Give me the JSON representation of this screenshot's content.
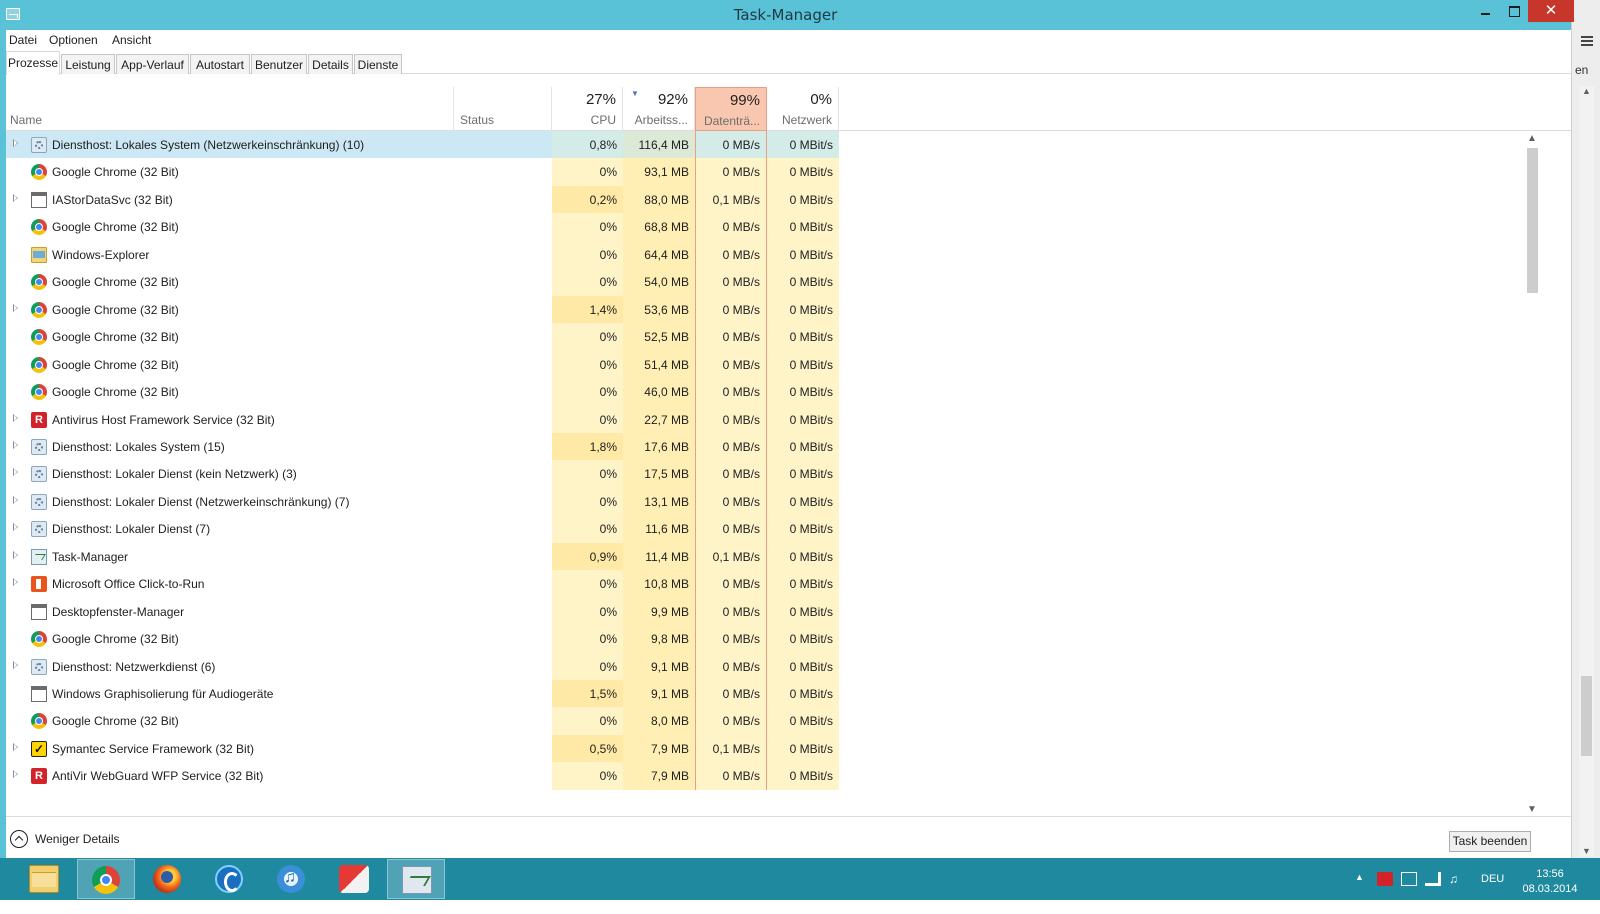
{
  "window": {
    "title": "Task-Manager"
  },
  "menu": [
    "Datei",
    "Optionen",
    "Ansicht"
  ],
  "tabs": [
    "Prozesse",
    "Leistung",
    "App-Verlauf",
    "Autostart",
    "Benutzer",
    "Details",
    "Dienste"
  ],
  "columns": {
    "name": "Name",
    "status": "Status",
    "cpu": {
      "pct": "27%",
      "label": "CPU"
    },
    "memory": {
      "pct": "92%",
      "label": "Arbeitss..."
    },
    "disk": {
      "pct": "99%",
      "label": "Datenträ..."
    },
    "network": {
      "pct": "0%",
      "label": "Netzwerk"
    }
  },
  "colors": {
    "titlebar": "#5ac2d6",
    "taskbar": "#1f8a9f",
    "hot_column": "#f9c7b0",
    "selected_row": "#cce8f4",
    "close_button": "#c7362b"
  },
  "rows": [
    {
      "name": "Diensthost: Lokales System (Netzwerkeinschränkung) (10)",
      "icon": "gear-icon",
      "expandable": true,
      "selected": true,
      "cpu": "0,8%",
      "mem": "116,4 MB",
      "disk": "0 MB/s",
      "net": "0 MBit/s"
    },
    {
      "name": "Google Chrome (32 Bit)",
      "icon": "chrome-icon",
      "expandable": false,
      "cpu": "0%",
      "mem": "93,1 MB",
      "disk": "0 MB/s",
      "net": "0 MBit/s"
    },
    {
      "name": "IAStorDataSvc (32 Bit)",
      "icon": "window-icon",
      "expandable": true,
      "cpu": "0,2%",
      "mem": "88,0 MB",
      "disk": "0,1 MB/s",
      "net": "0 MBit/s"
    },
    {
      "name": "Google Chrome (32 Bit)",
      "icon": "chrome-icon",
      "expandable": false,
      "cpu": "0%",
      "mem": "68,8 MB",
      "disk": "0 MB/s",
      "net": "0 MBit/s"
    },
    {
      "name": "Windows-Explorer",
      "icon": "folder-icon",
      "expandable": false,
      "cpu": "0%",
      "mem": "64,4 MB",
      "disk": "0 MB/s",
      "net": "0 MBit/s"
    },
    {
      "name": "Google Chrome (32 Bit)",
      "icon": "chrome-icon",
      "expandable": false,
      "cpu": "0%",
      "mem": "54,0 MB",
      "disk": "0 MB/s",
      "net": "0 MBit/s"
    },
    {
      "name": "Google Chrome (32 Bit)",
      "icon": "chrome-icon",
      "expandable": true,
      "cpu": "1,4%",
      "mem": "53,6 MB",
      "disk": "0 MB/s",
      "net": "0 MBit/s"
    },
    {
      "name": "Google Chrome (32 Bit)",
      "icon": "chrome-icon",
      "expandable": false,
      "cpu": "0%",
      "mem": "52,5 MB",
      "disk": "0 MB/s",
      "net": "0 MBit/s"
    },
    {
      "name": "Google Chrome (32 Bit)",
      "icon": "chrome-icon",
      "expandable": false,
      "cpu": "0%",
      "mem": "51,4 MB",
      "disk": "0 MB/s",
      "net": "0 MBit/s"
    },
    {
      "name": "Google Chrome (32 Bit)",
      "icon": "chrome-icon",
      "expandable": false,
      "cpu": "0%",
      "mem": "46,0 MB",
      "disk": "0 MB/s",
      "net": "0 MBit/s"
    },
    {
      "name": "Antivirus Host Framework Service (32 Bit)",
      "icon": "avira-icon",
      "expandable": true,
      "cpu": "0%",
      "mem": "22,7 MB",
      "disk": "0 MB/s",
      "net": "0 MBit/s"
    },
    {
      "name": "Diensthost: Lokales System (15)",
      "icon": "gear-icon",
      "expandable": true,
      "cpu": "1,8%",
      "mem": "17,6 MB",
      "disk": "0 MB/s",
      "net": "0 MBit/s"
    },
    {
      "name": "Diensthost: Lokaler Dienst (kein Netzwerk) (3)",
      "icon": "gear-icon",
      "expandable": true,
      "cpu": "0%",
      "mem": "17,5 MB",
      "disk": "0 MB/s",
      "net": "0 MBit/s"
    },
    {
      "name": "Diensthost: Lokaler Dienst (Netzwerkeinschränkung) (7)",
      "icon": "gear-icon",
      "expandable": true,
      "cpu": "0%",
      "mem": "13,1 MB",
      "disk": "0 MB/s",
      "net": "0 MBit/s"
    },
    {
      "name": "Diensthost: Lokaler Dienst (7)",
      "icon": "gear-icon",
      "expandable": true,
      "cpu": "0%",
      "mem": "11,6 MB",
      "disk": "0 MB/s",
      "net": "0 MBit/s"
    },
    {
      "name": "Task-Manager",
      "icon": "taskmgr-icon",
      "expandable": true,
      "cpu": "0,9%",
      "mem": "11,4 MB",
      "disk": "0,1 MB/s",
      "net": "0 MBit/s"
    },
    {
      "name": "Microsoft Office Click-to-Run",
      "icon": "office-icon",
      "expandable": true,
      "cpu": "0%",
      "mem": "10,8 MB",
      "disk": "0 MB/s",
      "net": "0 MBit/s"
    },
    {
      "name": "Desktopfenster-Manager",
      "icon": "window-icon",
      "expandable": false,
      "cpu": "0%",
      "mem": "9,9 MB",
      "disk": "0 MB/s",
      "net": "0 MBit/s"
    },
    {
      "name": "Google Chrome (32 Bit)",
      "icon": "chrome-icon",
      "expandable": false,
      "cpu": "0%",
      "mem": "9,8 MB",
      "disk": "0 MB/s",
      "net": "0 MBit/s"
    },
    {
      "name": "Diensthost: Netzwerkdienst (6)",
      "icon": "gear-icon",
      "expandable": true,
      "cpu": "0%",
      "mem": "9,1 MB",
      "disk": "0 MB/s",
      "net": "0 MBit/s"
    },
    {
      "name": "Windows Graphisolierung für Audiogeräte",
      "icon": "window-icon",
      "expandable": false,
      "cpu": "1,5%",
      "mem": "9,1 MB",
      "disk": "0 MB/s",
      "net": "0 MBit/s"
    },
    {
      "name": "Google Chrome (32 Bit)",
      "icon": "chrome-icon",
      "expandable": false,
      "cpu": "0%",
      "mem": "8,0 MB",
      "disk": "0 MB/s",
      "net": "0 MBit/s"
    },
    {
      "name": "Symantec Service Framework (32 Bit)",
      "icon": "check-icon",
      "expandable": true,
      "cpu": "0,5%",
      "mem": "7,9 MB",
      "disk": "0,1 MB/s",
      "net": "0 MBit/s"
    },
    {
      "name": "AntiVir WebGuard WFP Service (32 Bit)",
      "icon": "avira-icon",
      "expandable": true,
      "cpu": "0%",
      "mem": "7,9 MB",
      "disk": "0 MB/s",
      "net": "0 MBit/s"
    }
  ],
  "footer": {
    "fewer_details": "Weniger Details",
    "end_task": "Task beenden"
  },
  "background_window": {
    "text": "en"
  },
  "taskbar": {
    "apps": [
      "folder-icon",
      "chrome-icon",
      "firefox-icon",
      "cbox-icon",
      "itunes-icon",
      "ccleaner-icon",
      "taskmgr-icon"
    ],
    "language": "DEU",
    "time": "13:56",
    "date": "08.03.2014"
  }
}
